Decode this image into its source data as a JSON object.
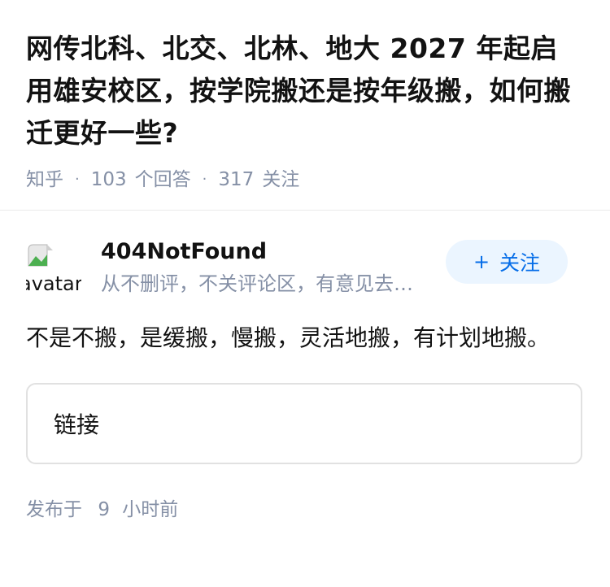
{
  "question": {
    "title": "网传北科、北交、北林、地大 2027 年起启用雄安校区，按学院搬还是按年级搬，如何搬迁更好一些?",
    "source": "知乎",
    "answer_count": "103",
    "answer_label": "个回答",
    "follow_count": "317",
    "follow_label": "关注"
  },
  "answer": {
    "avatar_alt": "avatar",
    "author_name": "404NotFound",
    "author_bio": "从不删评，不关评论区，有意见去…",
    "follow_button": {
      "icon": "+",
      "label": "关注"
    },
    "content": "不是不搬，是缓搬，慢搬，灵活地搬，有计划地搬。",
    "link_card_label": "链接",
    "publish_prefix": "发布于",
    "publish_value": "9",
    "publish_unit": "小时前"
  },
  "colors": {
    "accent": "#056de8",
    "accent_bg": "#ebf5ff",
    "meta_text": "#8590a6"
  }
}
